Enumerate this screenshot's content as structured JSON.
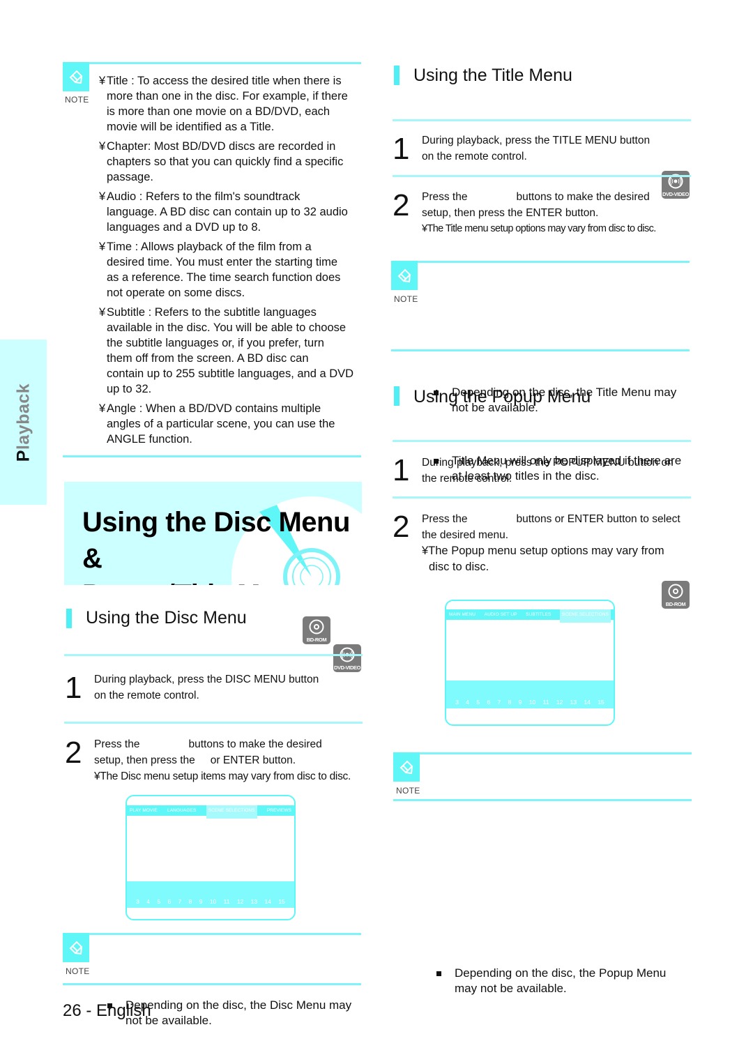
{
  "side_tab": {
    "label_first": "P",
    "label_rest": "layback"
  },
  "note_label": "NOTE",
  "intro_note": {
    "items": [
      {
        "lines": [
          "Title : To access the desired title when there is",
          "more than one in the disc. For example, if there",
          "is more than one movie on a BD/DVD, each",
          "movie will be identified as a Title."
        ]
      },
      {
        "lines": [
          "Chapter: Most BD/DVD discs are recorded in",
          "chapters so that you can quickly find a specific",
          "passage."
        ]
      },
      {
        "lines": [
          "Audio : Refers to the film's soundtrack",
          "language. A BD disc can contain up to 32 audio",
          "languages and a DVD up to 8."
        ]
      },
      {
        "lines": [
          "Time : Allows playback of the film from a",
          "desired time. You must enter the starting time",
          "as a reference. The time search function does",
          "not operate on some discs."
        ]
      },
      {
        "lines": [
          "Subtitle : Refers to the subtitle languages",
          "available in the disc. You will be able to choose",
          "the subtitle languages or, if you prefer, turn",
          "them off from the screen. A BD disc can",
          "contain up to 255 subtitle languages, and a DVD",
          "up to 32."
        ]
      },
      {
        "lines": [
          "Angle : When a BD/DVD contains multiple",
          "angles of a particular scene, you can use the",
          "ANGLE function."
        ]
      }
    ],
    "bullet_glyph": "¥"
  },
  "hero": {
    "line1": "Using the Disc Menu &",
    "line2": "Popup/Title Menu"
  },
  "disc_menu": {
    "title": "Using the Disc Menu",
    "badges": [
      "BD-ROM",
      "DVD-VIDEO"
    ],
    "step1": {
      "num": "1",
      "line1": "During playback, press the DISC MENU button",
      "line2": "on the remote control."
    },
    "step2": {
      "num": "2",
      "line1a": "Press the",
      "line1b": "buttons to make the desired",
      "line2a": "setup, then press the",
      "line2b": "or ENTER button.",
      "sub": "¥The Disc menu setup items may vary from disc to disc."
    },
    "screen": {
      "menu": [
        "PLAY MOVIE",
        "LANGUAGES",
        "SCENE SELECTIONS",
        "PREVIEWS"
      ],
      "active_index": 2,
      "numbers": [
        "3",
        "4",
        "5",
        "6",
        "7",
        "8",
        "9",
        "10",
        "11",
        "12",
        "13",
        "14",
        "15"
      ]
    },
    "note": {
      "line1": "Depending on the disc, the Disc Menu may",
      "line2": "not be available."
    }
  },
  "title_menu": {
    "title": "Using the Title Menu",
    "badges": [
      "DVD-VIDEO"
    ],
    "step1": {
      "num": "1",
      "line1": "During playback, press the TITLE MENU button",
      "line2": "on the remote control."
    },
    "step2": {
      "num": "2",
      "line1a": "Press the",
      "line1b": "buttons to make the desired",
      "line2": "setup, then press the ENTER button.",
      "sub": "¥The Title menu setup options may vary from disc to disc."
    },
    "note": {
      "items": [
        {
          "line1": "Depending on the disc, the Title Menu may",
          "line2": "not be available."
        },
        {
          "line1": "Title Menu will only be displayed if there are",
          "line2": "at least two titles in the disc."
        }
      ]
    }
  },
  "popup_menu": {
    "title": "Using the Popup Menu",
    "badges": [
      "BD-ROM"
    ],
    "step1": {
      "num": "1",
      "line1": "During playback, press the POPUP MENU button on",
      "line2": "the remote control."
    },
    "step2": {
      "num": "2",
      "line1a": "Press the",
      "line1b": "buttons or ENTER button to select",
      "line2": "the desired menu.",
      "sub1": "¥The Popup menu setup options may vary from",
      "sub2": "disc to disc."
    },
    "screen": {
      "menu": [
        "MAIN MENU",
        "AUDIO SET UP",
        "SUBTITLES",
        "SCENE SELECTIONS"
      ],
      "active_index": 3,
      "numbers": [
        "3",
        "4",
        "5",
        "6",
        "7",
        "8",
        "9",
        "10",
        "11",
        "12",
        "13",
        "14",
        "15"
      ]
    },
    "note": {
      "line1": "Depending on the disc, the Popup Menu",
      "line2": "may not be available."
    }
  },
  "footer": {
    "page": "26 - English"
  },
  "colors": {
    "accent": "#5ff6f8",
    "tab_bg": "#ccffff",
    "badge": "#7a7a7a"
  }
}
